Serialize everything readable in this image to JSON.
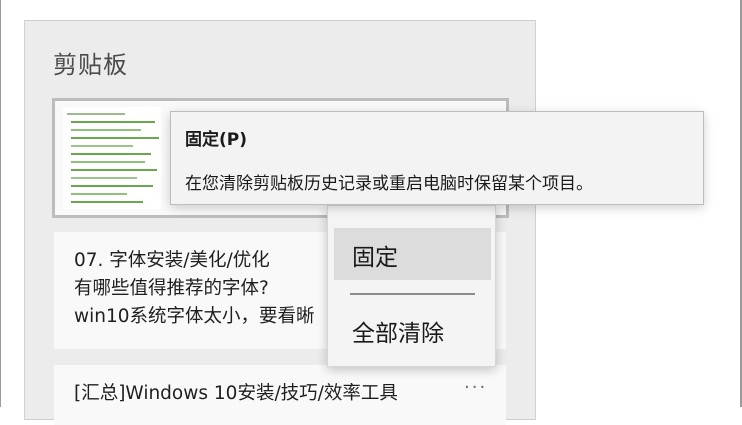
{
  "panel": {
    "title": "剪贴板"
  },
  "clip_items": [
    {
      "type": "image"
    },
    {
      "lines": [
        "07. 字体安装/美化/优化",
        "有哪些值得推荐的字体?",
        "win10系统字体太小，要看晰"
      ]
    },
    {
      "lines": [
        "[汇总]Windows 10安装/技巧/效率工具"
      ],
      "more_label": "···"
    }
  ],
  "context_menu": {
    "items": [
      {
        "label": "固定"
      },
      {
        "label": "全部清除"
      }
    ]
  },
  "tooltip": {
    "title": "固定(P)",
    "description": "在您清除剪贴板历史记录或重启电脑时保留某个项目。"
  },
  "colors": {
    "panel_bg": "#ececec",
    "card_bg": "#f9f9f9",
    "accent_green": "#6aa84f"
  }
}
